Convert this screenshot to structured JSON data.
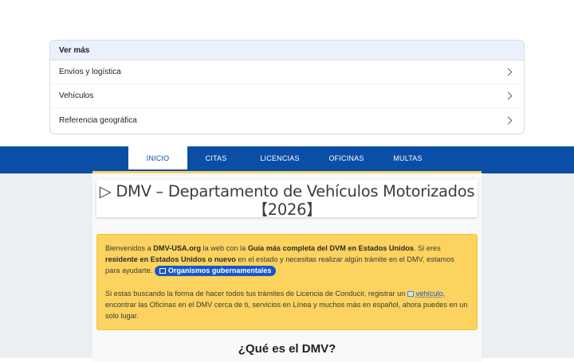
{
  "vermas": {
    "header": "Ver más",
    "items": [
      {
        "label": "Envíos y logística"
      },
      {
        "label": "Vehículos"
      },
      {
        "label": "Referencia geográfica"
      }
    ]
  },
  "nav": {
    "tabs": [
      {
        "label": "INICIO",
        "active": true
      },
      {
        "label": "CITAS"
      },
      {
        "label": "LICENCIAS"
      },
      {
        "label": "OFICINAS"
      },
      {
        "label": "MULTAS"
      }
    ]
  },
  "main": {
    "title_line1": "▷ DMV – Departamento de Vehículos Motorizados",
    "title_line2": "【2026】",
    "notice": {
      "p1_a": "Bienvenidos a ",
      "p1_site": "DMV-USA.org",
      "p1_b": " la web con la ",
      "p1_guide": "Guía más completa del DVM en Estados Unidos",
      "p1_c": ". Si eres ",
      "p1_resident": "residente en Estados Unidos o nuevo",
      "p1_d": " en el estado y necesitas realizar algún trámite en el DMV, estamos para ayudarte.",
      "badge": "Organismos gubernamentales",
      "p2_a": "Si estas buscando la forma de hacer todos tus trámites de Licencia de Conducir, registrar un ",
      "p2_link": "vehículo",
      "p2_b": ", encontrar las Oficinas en el DMV cerca de ti, servicios en Línea y muchos más en español, ahora puedes en un solo lugar."
    },
    "section_heading": "¿Qué es el DMV?"
  }
}
